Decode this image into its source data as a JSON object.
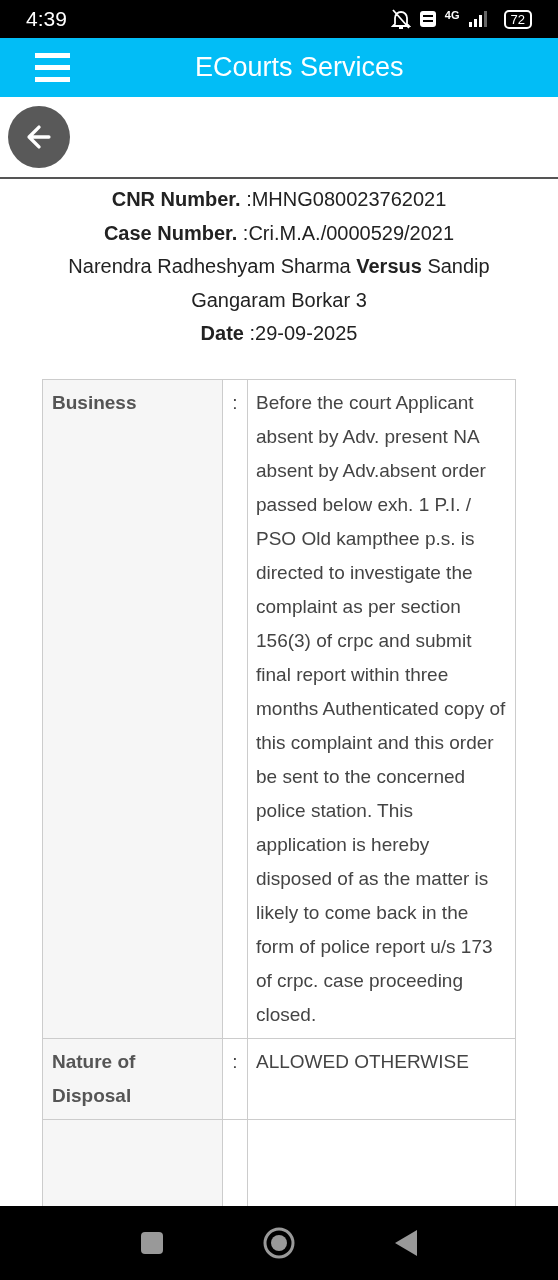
{
  "status_bar": {
    "time": "4:39",
    "network": "4G",
    "battery": "72"
  },
  "app_bar": {
    "title": "ECourts Services"
  },
  "case_header": [
    "**CNR Number.** :MHNG080023762021",
    "**Case Number.** :Cri.M.A./0000529/2021",
    "Narendra Radheshyam Sharma **Versus** Sandip Gangaram Borkar 3",
    "**Date** :29-09-2025"
  ],
  "table": {
    "rows": [
      {
        "label": "Business",
        "separator": ":",
        "value": "Before the court Applicant absent by Adv. present NA absent by Adv.absent order passed below exh. 1 P.I. / PSO Old kampthee p.s. is directed to investigate the complaint as per section 156(3) of crpc and submit final report within three months Authenticated copy of this complaint and this order be sent to the concerned police station. This application is hereby disposed of as the matter is likely to come back in the form of police report u/s 173 of crpc. case proceeding closed."
      },
      {
        "label": "Nature of Disposal",
        "separator": ":",
        "value": "ALLOWED OTHERWISE"
      }
    ]
  }
}
